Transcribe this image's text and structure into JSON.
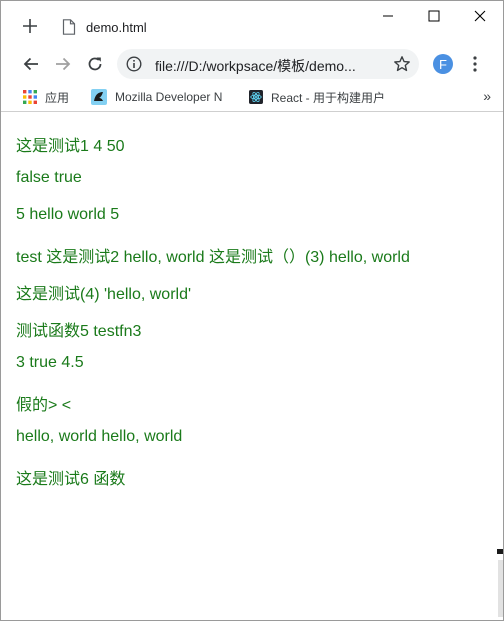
{
  "tab": {
    "title": "demo.html"
  },
  "toolbar": {
    "url": "file:///D:/workpsace/模板/demo...",
    "profile_initial": "F"
  },
  "bookmarks": {
    "items": [
      {
        "label": "应用",
        "icon": "apps-grid-icon"
      },
      {
        "label": "Mozilla Developer N",
        "icon": "mdn-icon"
      },
      {
        "label": "React - 用于构建用户",
        "icon": "react-icon"
      }
    ],
    "more": "»"
  },
  "page": {
    "lines": [
      "这是测试1 4 50",
      "false true",
      "5 hello world 5",
      "test 这是测试2 hello, world 这是测试（）(3) hello, world",
      "这是测试(4) 'hello, world'",
      "测试函数5 testfn3",
      "3 true 4.5",
      "假的> <",
      "hello, world hello, world",
      "这是测试6 函数"
    ]
  },
  "colors": {
    "content_text": "#1a7a1a",
    "profile_avatar": "#4a90e2",
    "omnibox_bg": "#f1f3f4"
  }
}
